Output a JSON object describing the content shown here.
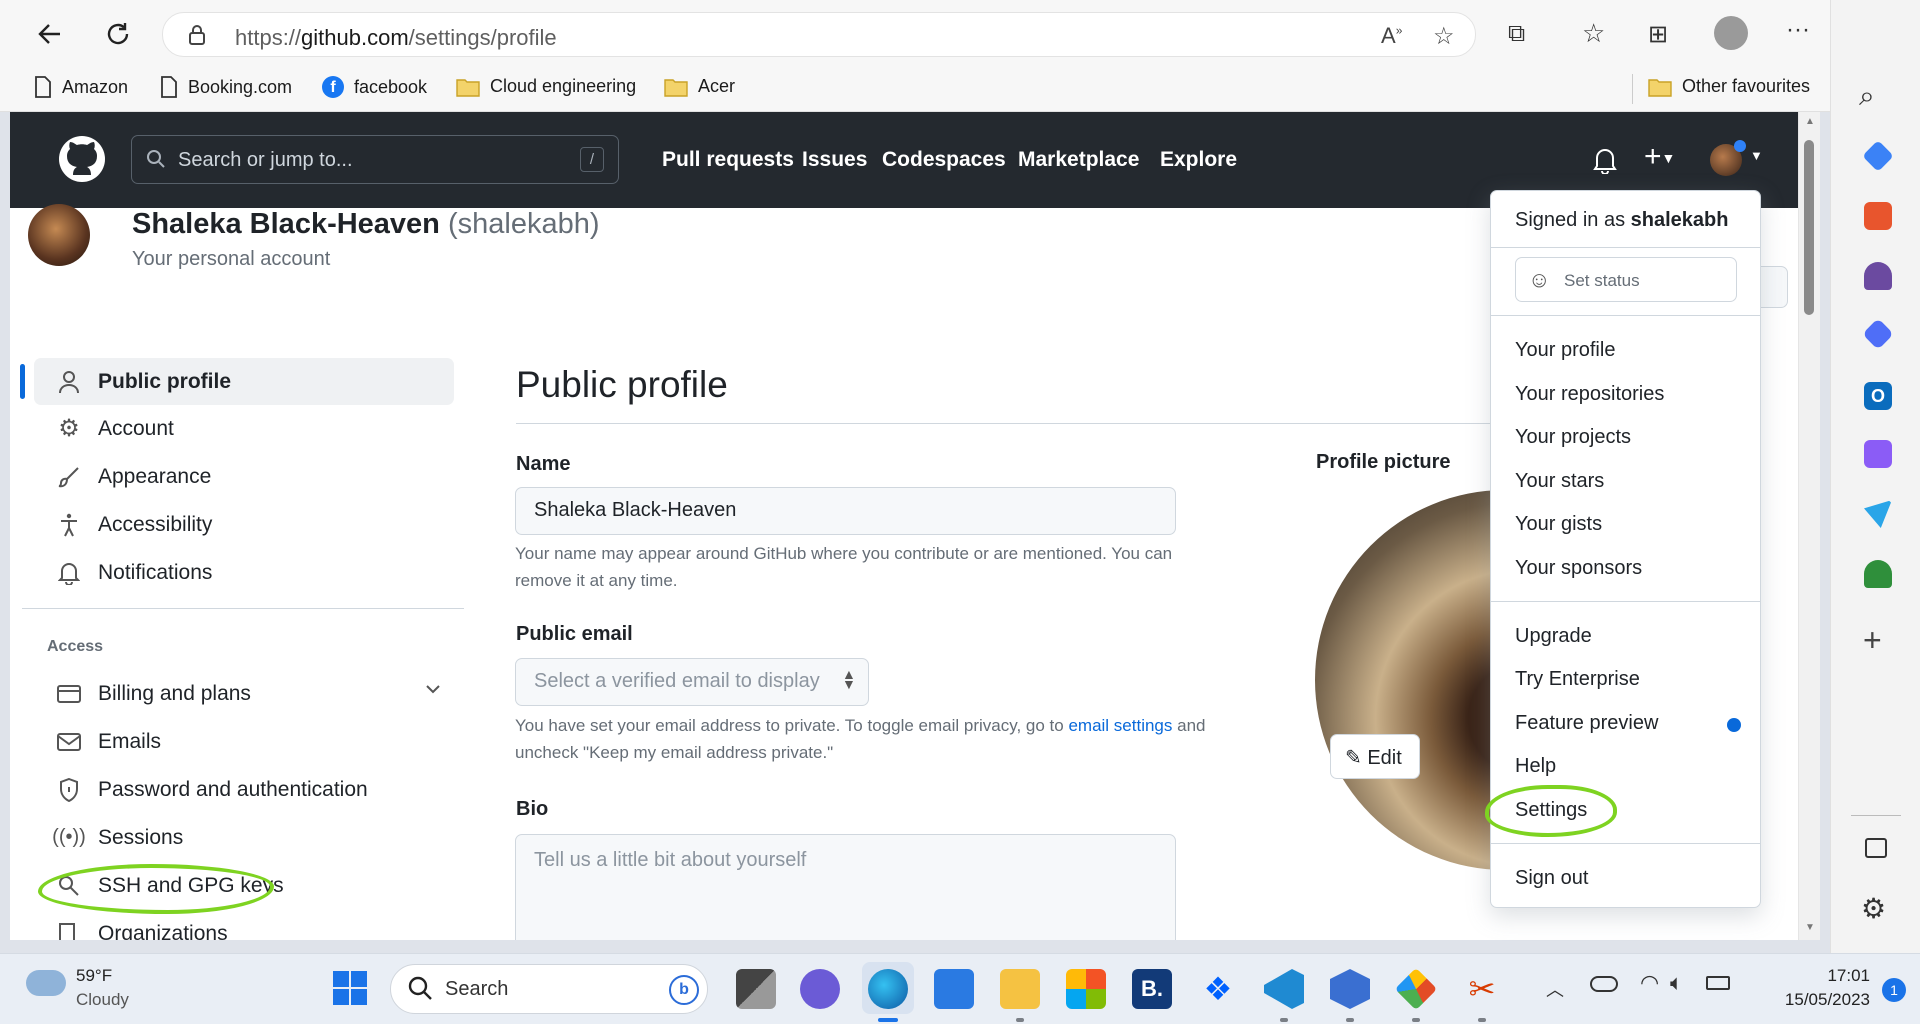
{
  "browser": {
    "url_prefix": "https://",
    "url_host": "github.com",
    "url_path": "/settings/profile",
    "bookmarks": [
      "Amazon",
      "Booking.com",
      "facebook",
      "Cloud engineering",
      "Acer"
    ],
    "other_favourites": "Other favourites"
  },
  "github": {
    "search_placeholder": "Search or jump to...",
    "search_key": "/",
    "nav": [
      "Pull requests",
      "Issues",
      "Codespaces",
      "Marketplace",
      "Explore"
    ]
  },
  "account": {
    "name": "Shaleka Black-Heaven",
    "handle": "(shalekabh)",
    "subtitle": "Your personal account"
  },
  "sidenav": {
    "items": [
      "Public profile",
      "Account",
      "Appearance",
      "Accessibility",
      "Notifications"
    ],
    "access_heading": "Access",
    "access_items": [
      "Billing and plans",
      "Emails",
      "Password and authentication",
      "Sessions",
      "SSH and GPG keys",
      "Organizations"
    ]
  },
  "main": {
    "title": "Public profile",
    "name_label": "Name",
    "name_value": "Shaleka Black-Heaven",
    "name_note_1": "Your name may appear around GitHub where you contribute or are mentioned. You can",
    "name_note_2": "remove it at any time.",
    "email_label": "Public email",
    "email_select": "Select a verified email to display",
    "email_note_1a": "You have set your email address to private. To toggle email privacy, go to ",
    "email_note_link": "email settings",
    "email_note_1b": " and",
    "email_note_2": "uncheck \"Keep my email address private.\"",
    "bio_label": "Bio",
    "bio_placeholder": "Tell us a little bit about yourself",
    "picture_label": "Profile picture",
    "edit_label": "Edit"
  },
  "dropdown": {
    "signed_in_prefix": "Signed in as ",
    "username": "shalekabh",
    "set_status": "Set status",
    "group1": [
      "Your profile",
      "Your repositories",
      "Your projects",
      "Your stars",
      "Your gists",
      "Your sponsors"
    ],
    "group2": [
      "Upgrade",
      "Try Enterprise",
      "Feature preview",
      "Help",
      "Settings"
    ],
    "sign_out": "Sign out"
  },
  "taskbar": {
    "weather_temp": "59°F",
    "weather_desc": "Cloudy",
    "search": "Search",
    "time": "17:01",
    "date": "15/05/2023",
    "notification_count": "1"
  },
  "colors": {
    "header": "#24292f",
    "accent": "#0969da",
    "highlight": "#7ed321",
    "active_indicator": "#0969da"
  }
}
